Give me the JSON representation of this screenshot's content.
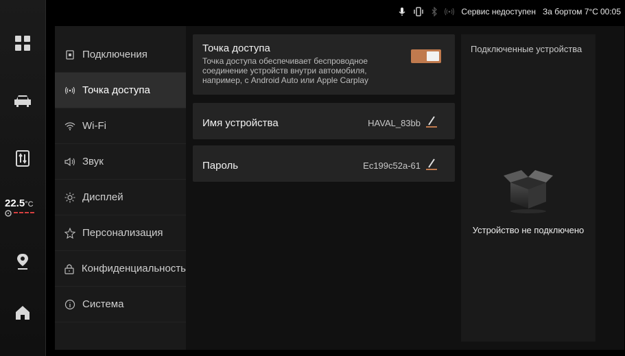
{
  "status_bar": {
    "service_text": "Сервис недоступен",
    "outside_temp": "За бортом 7°C",
    "time": "00:05",
    "icons": [
      "microphone-icon",
      "vibrate-icon",
      "bluetooth-icon",
      "hotspot-icon"
    ]
  },
  "dock": {
    "temperature_value": "22.5",
    "temperature_unit": "°C",
    "items": [
      "apps-icon",
      "car-icon",
      "split-screen-icon",
      "navigation-icon",
      "home-icon"
    ]
  },
  "nav": {
    "items": [
      {
        "label": "Подключения",
        "icon": "connections-icon"
      },
      {
        "label": "Точка доступа",
        "icon": "hotspot-icon"
      },
      {
        "label": "Wi-Fi",
        "icon": "wifi-icon"
      },
      {
        "label": "Звук",
        "icon": "speaker-icon"
      },
      {
        "label": "Дисплей",
        "icon": "brightness-icon"
      },
      {
        "label": "Персонализация",
        "icon": "personalization-icon"
      },
      {
        "label": "Конфиденциальность",
        "icon": "lock-icon"
      },
      {
        "label": "Система",
        "icon": "info-icon"
      }
    ],
    "active_index": 1
  },
  "hotspot": {
    "title": "Точка доступа",
    "description": "Точка доступа обеспечивает беспроводное соединение устройств внутри автомобиля, например, с Android Auto или Apple Carplay",
    "enabled": true
  },
  "device_name": {
    "label": "Имя устройства",
    "value": "HAVAL_83bb"
  },
  "password": {
    "label": "Пароль",
    "value": "Ec199c52a-61"
  },
  "devices_panel": {
    "header": "Подключенные устройства",
    "empty_text": "Устройство не подключено"
  },
  "colors": {
    "accent": "#c07a4e",
    "background": "#111111"
  }
}
